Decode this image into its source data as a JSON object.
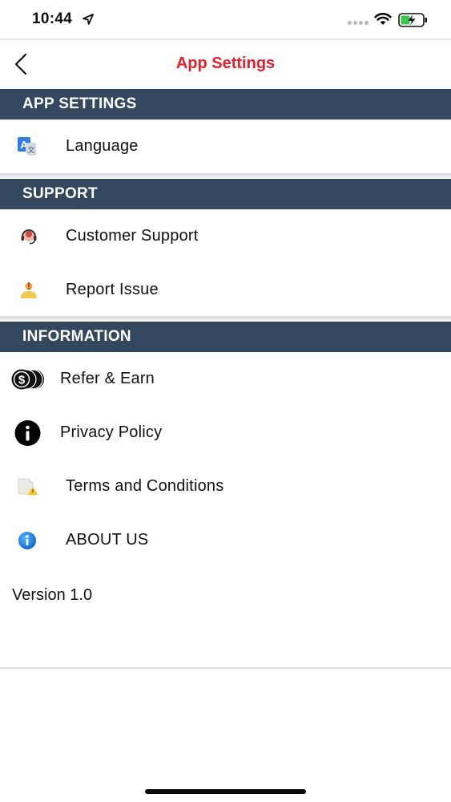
{
  "status_bar": {
    "time": "10:44"
  },
  "header": {
    "title": "App Settings",
    "title_color": "#e0202a"
  },
  "sections": [
    {
      "title": "APP SETTINGS",
      "items": [
        {
          "label": "Language",
          "icon": "translate-icon"
        }
      ]
    },
    {
      "title": "SUPPORT",
      "items": [
        {
          "label": "Customer Support",
          "icon": "headset-icon"
        },
        {
          "label": "Report Issue",
          "icon": "report-issue-icon"
        }
      ]
    },
    {
      "title": "INFORMATION",
      "items": [
        {
          "label": "Refer & Earn",
          "icon": "coins-icon"
        },
        {
          "label": "Privacy Policy",
          "icon": "info-circle-icon"
        },
        {
          "label": "Terms and Conditions",
          "icon": "document-warning-icon"
        },
        {
          "label": "ABOUT US",
          "icon": "info-blue-icon"
        }
      ]
    }
  ],
  "version": "Version 1.0",
  "colors": {
    "section_header_bg": "#33475f",
    "section_header_text": "#ffffff"
  }
}
